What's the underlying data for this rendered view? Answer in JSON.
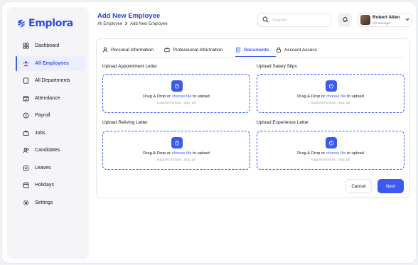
{
  "app": {
    "name": "Emplora"
  },
  "sidebar": {
    "items": [
      {
        "label": "Dashboard",
        "icon": "grid-icon"
      },
      {
        "label": "All Employees",
        "icon": "users-icon",
        "active": true
      },
      {
        "label": "All Departments",
        "icon": "building-icon"
      },
      {
        "label": "Attendance",
        "icon": "calendar-check-icon"
      },
      {
        "label": "Payroll",
        "icon": "dollar-icon"
      },
      {
        "label": "Jobs",
        "icon": "briefcase-icon"
      },
      {
        "label": "Candidates",
        "icon": "user-group-icon"
      },
      {
        "label": "Leaves",
        "icon": "clipboard-icon"
      },
      {
        "label": "Holidays",
        "icon": "calendar-icon"
      },
      {
        "label": "Settings",
        "icon": "gear-icon"
      }
    ]
  },
  "header": {
    "title": "Add New Employee",
    "breadcrumb": [
      "All Employee",
      "Add New Employee"
    ],
    "search_placeholder": "Search",
    "user": {
      "name": "Robert Allen",
      "role": "HR Manager"
    }
  },
  "tabs": [
    {
      "label": "Personal Information",
      "icon": "user-icon"
    },
    {
      "label": "Professional Information",
      "icon": "briefcase-icon"
    },
    {
      "label": "Documents",
      "icon": "document-icon",
      "active": true
    },
    {
      "label": "Account Access",
      "icon": "lock-icon"
    }
  ],
  "uploads": [
    {
      "label": "Upload Appointment Letter",
      "prompt_before": "Drag & Drop or ",
      "prompt_link": "choose file",
      "prompt_after": " to upload",
      "formats": "Supported formats : Jpeg, pdf"
    },
    {
      "label": "Upload Salary Slips",
      "prompt_before": "Drag & Drop or ",
      "prompt_link": "choose file",
      "prompt_after": " to upload",
      "formats": "Supported formats : Jpeg, pdf"
    },
    {
      "label": "Upload Reliving Letter",
      "prompt_before": "Drag & Drop or ",
      "prompt_link": "choose file",
      "prompt_after": " to upload",
      "formats": "Supported formats : Jpeg, pdf"
    },
    {
      "label": "Upload Experience Letter",
      "prompt_before": "Drag & Drop or ",
      "prompt_link": "choose file",
      "prompt_after": " to upload",
      "formats": "Supported formats : Jpeg, pdf"
    }
  ],
  "actions": {
    "cancel": "Cancel",
    "next": "Next"
  },
  "colors": {
    "accent": "#3b5bf0",
    "title": "#2b3fc8",
    "sidebar_bg": "#f5f5f7"
  }
}
